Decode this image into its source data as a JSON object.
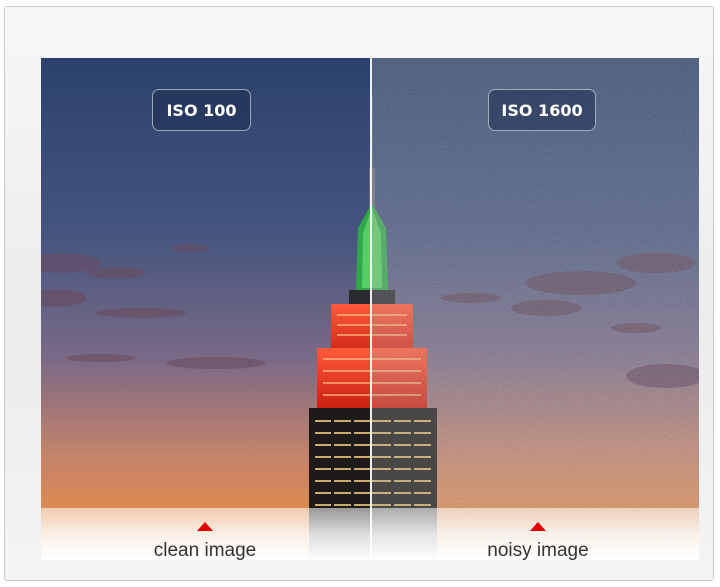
{
  "left_panel": {
    "iso_label": "ISO 100",
    "caption": "clean image"
  },
  "right_panel": {
    "iso_label": "ISO 1600",
    "caption": "noisy image"
  },
  "colors": {
    "sky_top": "#2e4470",
    "sky_horizon": "#e08a4a",
    "spire_green": "#3fb84f",
    "tower_red": "#e8321e",
    "caption_marker": "#e00000"
  }
}
